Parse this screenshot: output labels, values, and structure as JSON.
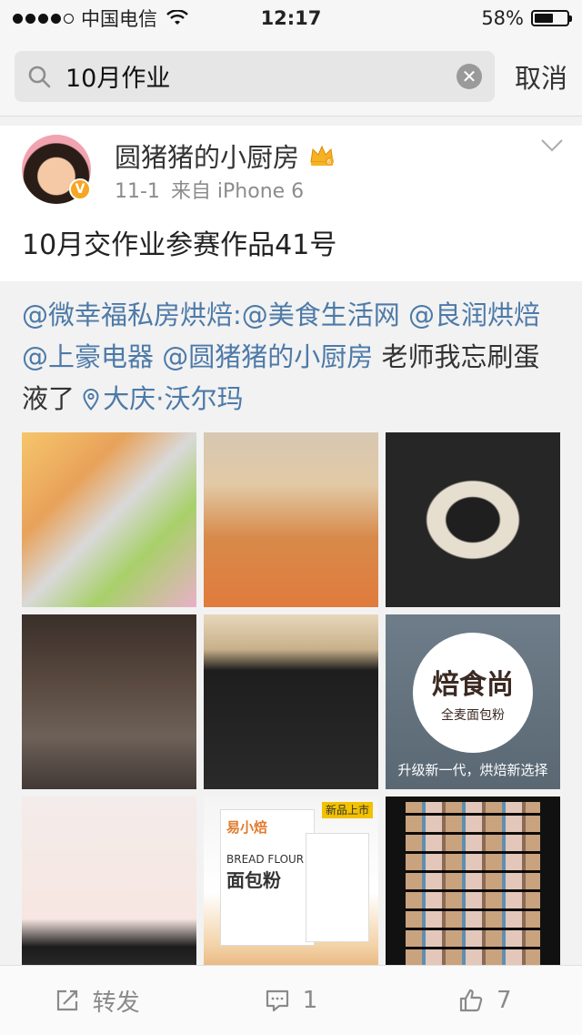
{
  "status_bar": {
    "carrier": "中国电信",
    "time": "12:17",
    "battery_percent": "58%",
    "battery_level": 0.58
  },
  "search": {
    "query": "10月作业",
    "cancel_label": "取消"
  },
  "post": {
    "username": "圆猪猪的小厨房",
    "date": "11-1",
    "source": "来自 iPhone 6",
    "title": "10月交作业参赛作品41号",
    "repost": {
      "mention1": "@微幸福私房烘焙",
      "colon": ":",
      "mention2": "@美食生活网",
      "mention3": "@良润烘焙",
      "mention4": "@上豪电器",
      "mention5": "@圆猪猪的小厨房",
      "text": "老师我忘刷蛋液了",
      "location": "大庆·沃尔玛"
    },
    "images": {
      "img6_title": "焙食尚",
      "img6_subtitle": "全麦面包粉",
      "img6_caption": "升级新一代，烘焙新选择",
      "img8_brand": "易小焙",
      "img8_flour_en": "BREAD FLOUR",
      "img8_flour_cn": "面包粉",
      "img8_tag": "新品上市"
    }
  },
  "actions": {
    "repost_label": "转发",
    "comment_count": "1",
    "like_count": "7"
  }
}
